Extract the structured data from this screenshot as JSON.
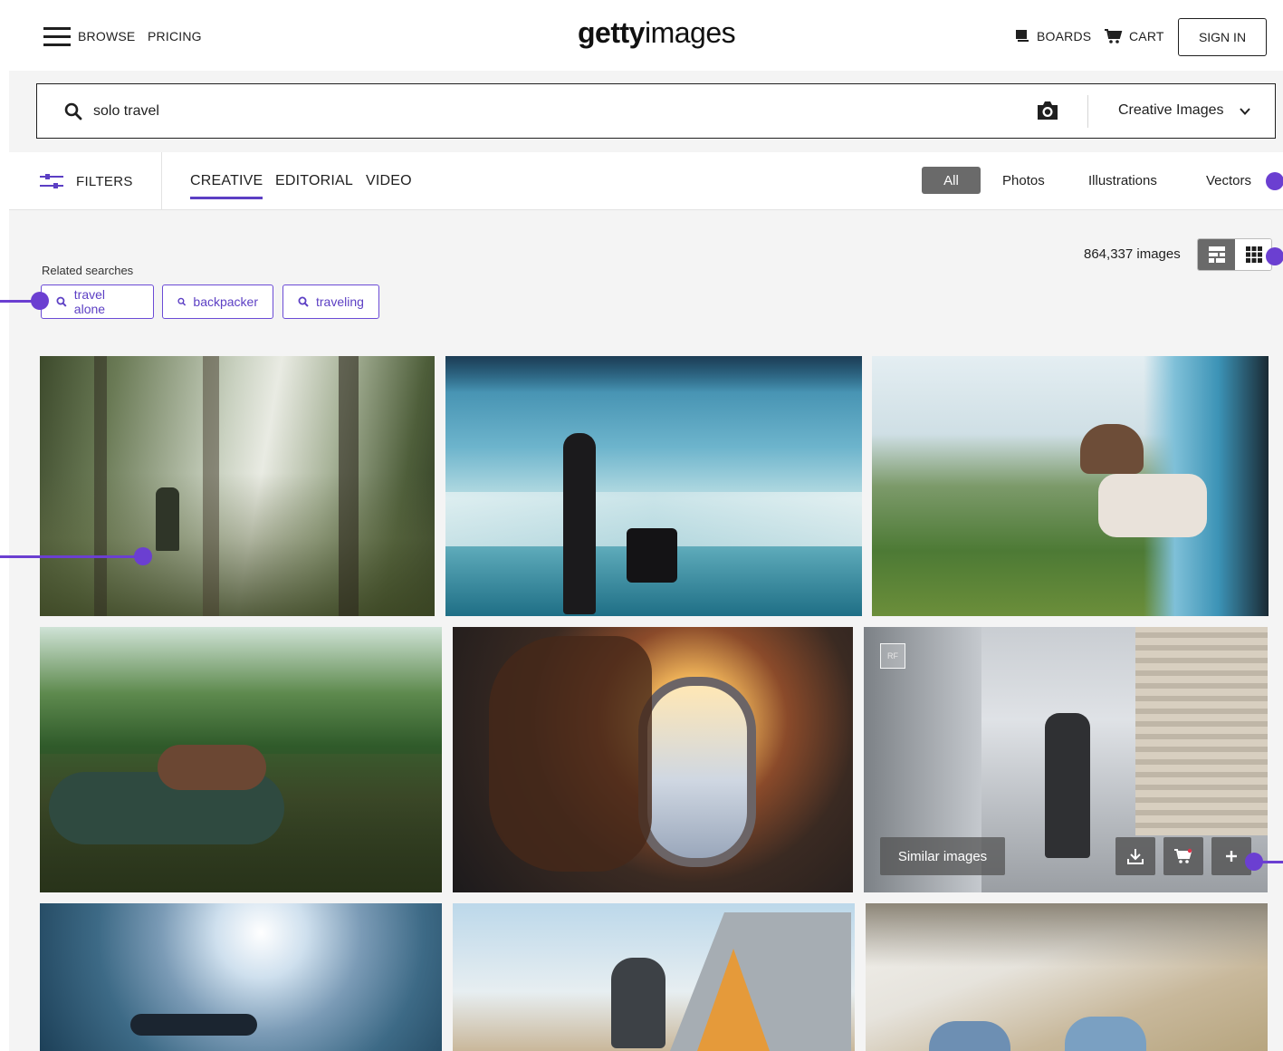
{
  "header": {
    "browse_label": "BROWSE",
    "pricing_label": "PRICING",
    "logo_bold": "getty",
    "logo_light": "images",
    "boards_label": "BOARDS",
    "cart_label": "CART",
    "signin_label": "SIGN IN"
  },
  "search": {
    "value": "solo travel",
    "scope_label": "Creative Images"
  },
  "filterbar": {
    "filters_label": "FILTERS",
    "tabs": [
      {
        "label": "CREATIVE",
        "active": true
      },
      {
        "label": "EDITORIAL",
        "active": false
      },
      {
        "label": "VIDEO",
        "active": false
      }
    ],
    "media_types": [
      "All",
      "Photos",
      "Illustrations",
      "Vectors"
    ],
    "selected_media": "All"
  },
  "results": {
    "count_label": "864,337 images",
    "related_label": "Related searches",
    "related": [
      "travel alone",
      "backpacker",
      "traveling"
    ]
  },
  "hover_tile": {
    "badge": "RF",
    "similar_label": "Similar images",
    "actions": [
      "download-icon",
      "cart-icon",
      "plus-icon"
    ]
  },
  "images": [
    {
      "name": "hiker-in-misty-forest-image"
    },
    {
      "name": "woman-with-suitcase-at-airport-image"
    },
    {
      "name": "woman-leaning-out-train-window-image"
    },
    {
      "name": "woman-floating-on-tube-in-river-image"
    },
    {
      "name": "man-looking-out-airplane-window-image"
    },
    {
      "name": "businessman-walking-with-bag-image"
    },
    {
      "name": "snorkeler-underwater-image"
    },
    {
      "name": "man-with-phone-by-tent-image"
    },
    {
      "name": "feet-on-beach-waves-image"
    }
  ],
  "colors": {
    "accent": "#5c3fc4",
    "annotation": "#6b3fd1",
    "selected_bg": "#6a6a6a"
  }
}
